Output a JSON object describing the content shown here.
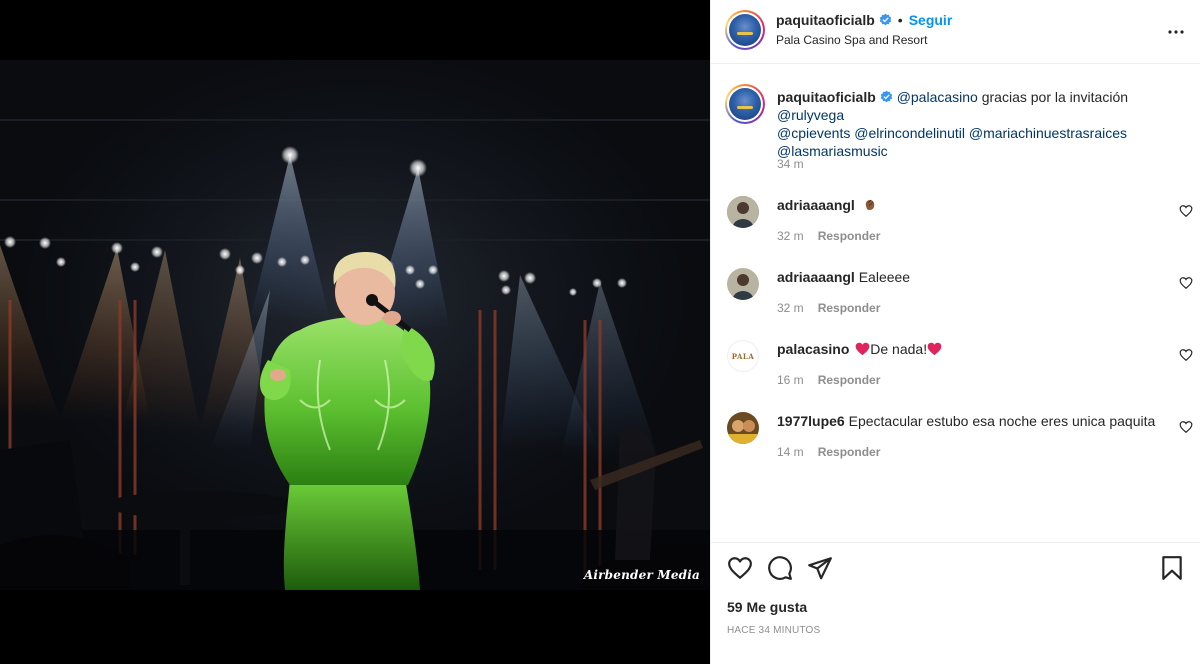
{
  "post": {
    "author": "paquitaoficialb",
    "follow_label": "Seguir",
    "separator": "•",
    "location": "Pala Casino Spa and Resort",
    "watermark": "Airbender Media",
    "caption": {
      "author": "paquitaoficialb",
      "parts": [
        {
          "text": "@palacasino",
          "mention": true
        },
        {
          "text": " gracias por la invitación ",
          "mention": false
        },
        {
          "text": "@rulyvega",
          "mention": true
        },
        {
          "text": " ",
          "mention": false
        },
        {
          "text": "@cpievents",
          "mention": true
        },
        {
          "text": " ",
          "mention": false
        },
        {
          "text": "@elrincondelinutil",
          "mention": true
        },
        {
          "text": " ",
          "mention": false
        },
        {
          "text": "@mariachinuestrasraices",
          "mention": true
        },
        {
          "text": " ",
          "mention": false
        },
        {
          "text": "@lasmariasmusic",
          "mention": true
        }
      ],
      "line1": [
        "@palacasino",
        " gracias por la invitación ",
        "@rulyvega"
      ],
      "line2": [
        "@cpievents",
        "@elrincondelinutil",
        "@mariachinuestrasraices"
      ],
      "line3": "@lasmariasmusic",
      "time": "34 m"
    },
    "comments": [
      {
        "user": "adriaaaangl",
        "text": "",
        "emoji": "clapping-hands",
        "time": "32 m",
        "reply": "Responder"
      },
      {
        "user": "adriaaaangl",
        "text": "Ealeeee",
        "emoji": "",
        "time": "32 m",
        "reply": "Responder"
      },
      {
        "user": "palacasino",
        "text": "De nada!",
        "emoji": "red-heart",
        "time": "16 m",
        "reply": "Responder",
        "avatar_text": "PALA"
      },
      {
        "user": "1977lupe6",
        "text": "Epectacular estubo esa noche eres unica paquita",
        "emoji": "",
        "time": "14 m",
        "reply": "Responder"
      }
    ],
    "likes": "59 Me gusta",
    "posted": "HACE 34 MINUTOS"
  },
  "colors": {
    "link": "#0095f6",
    "mention": "#00376b",
    "muted": "#8e8e8e",
    "text": "#262626",
    "verified": "#3897f0",
    "heart": "#ed4956",
    "dress": "#6fd13a"
  },
  "icons": [
    "verified-badge-icon",
    "more-options-icon",
    "heart-icon",
    "comment-icon",
    "share-icon",
    "bookmark-icon",
    "like-comment-icon"
  ]
}
